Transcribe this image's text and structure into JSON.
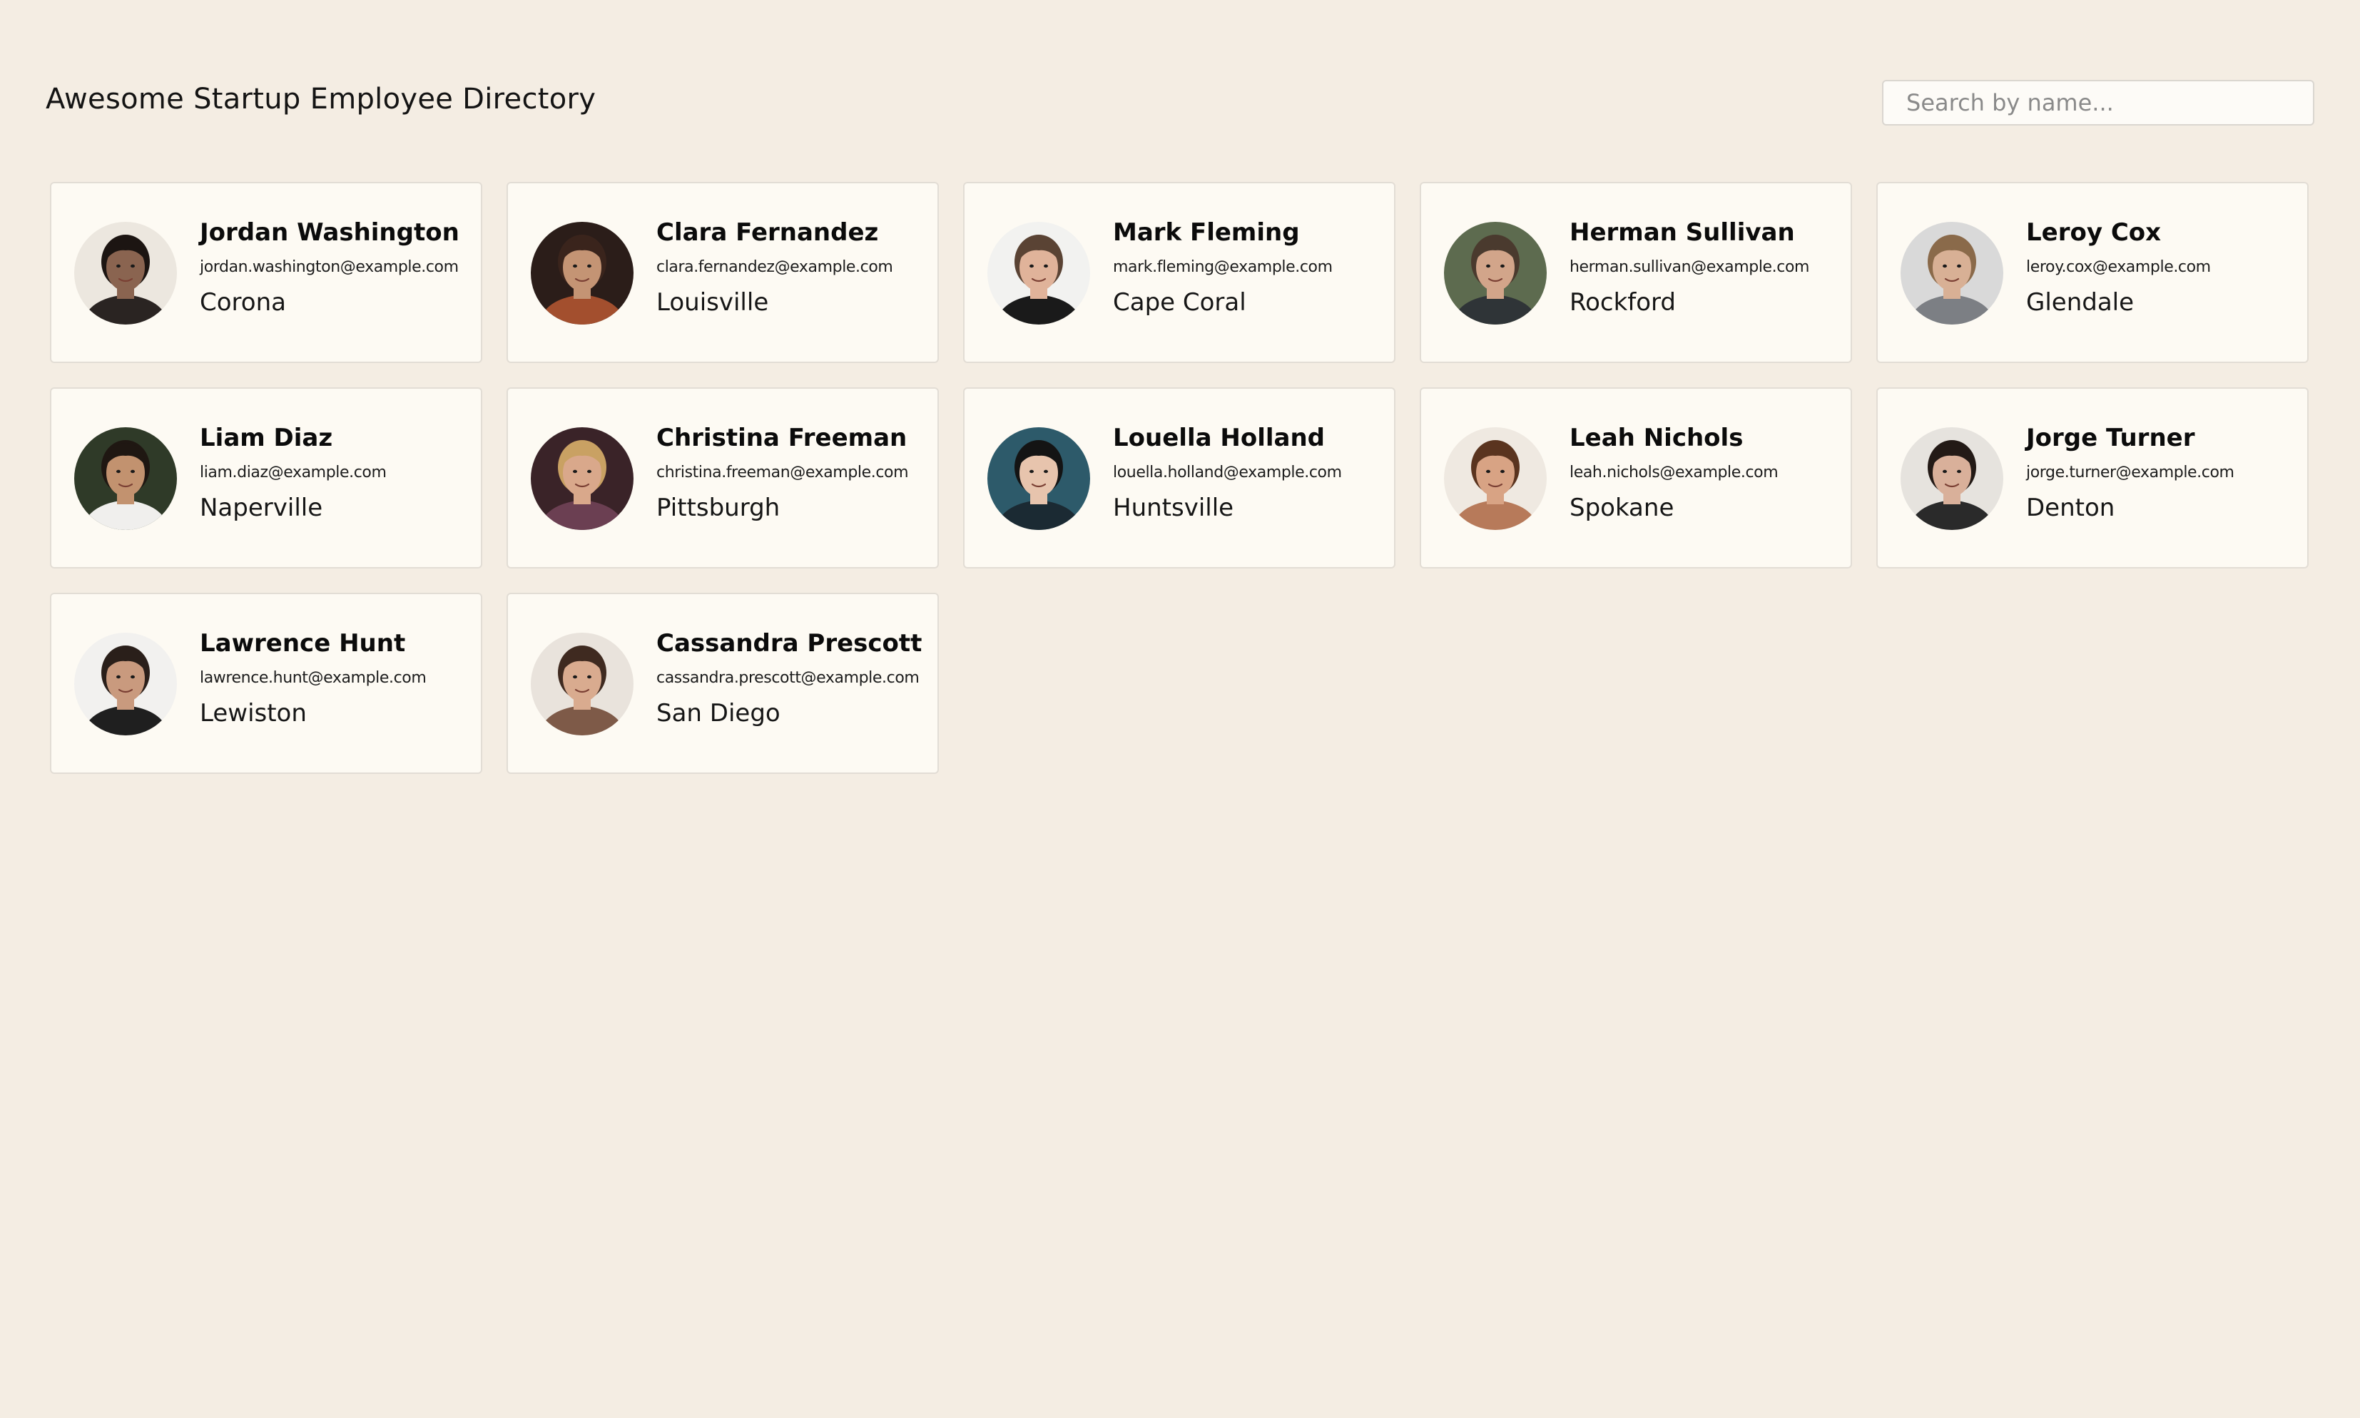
{
  "header": {
    "title": "Awesome Startup Employee Directory",
    "search_placeholder": "Search by name..."
  },
  "employees": [
    {
      "name": "Jordan Washington",
      "email": "jordan.washington@example.com",
      "city": "Corona",
      "bg": "#ece7df",
      "skin": "#8a6450",
      "hair": "#1c1512",
      "shirt": "#2a2422"
    },
    {
      "name": "Clara Fernandez",
      "email": "clara.fernandez@example.com",
      "city": "Louisville",
      "bg": "#2b1d19",
      "skin": "#c49474",
      "hair": "#3a241c",
      "shirt": "#a34f2e"
    },
    {
      "name": "Mark Fleming",
      "email": "mark.fleming@example.com",
      "city": "Cape Coral",
      "bg": "#f2f2f0",
      "skin": "#e0b39a",
      "hair": "#5a4334",
      "shirt": "#1a1a1a"
    },
    {
      "name": "Herman Sullivan",
      "email": "herman.sullivan@example.com",
      "city": "Rockford",
      "bg": "#5d6b4f",
      "skin": "#d2a58a",
      "hair": "#4a3a2e",
      "shirt": "#2f3437"
    },
    {
      "name": "Leroy Cox",
      "email": "leroy.cox@example.com",
      "city": "Glendale",
      "bg": "#d9d9d9",
      "skin": "#d8b095",
      "hair": "#8a6a4a",
      "shirt": "#7c7f84"
    },
    {
      "name": "Liam Diaz",
      "email": "liam.diaz@example.com",
      "city": "Naperville",
      "bg": "#2f3a28",
      "skin": "#c2926f",
      "hair": "#1f1712",
      "shirt": "#f0efed"
    },
    {
      "name": "Christina Freeman",
      "email": "christina.freeman@example.com",
      "city": "Pittsburgh",
      "bg": "#3a2328",
      "skin": "#d9a88b",
      "hair": "#c9a163",
      "shirt": "#6b3f52"
    },
    {
      "name": "Louella Holland",
      "email": "louella.holland@example.com",
      "city": "Huntsville",
      "bg": "#2d5a6a",
      "skin": "#e7c4ad",
      "hair": "#141414",
      "shirt": "#1b2a33"
    },
    {
      "name": "Leah Nichols",
      "email": "leah.nichols@example.com",
      "city": "Spokane",
      "bg": "#efe9e1",
      "skin": "#d8a384",
      "hair": "#5a341f",
      "shirt": "#b77a5a"
    },
    {
      "name": "Jorge Turner",
      "email": "jorge.turner@example.com",
      "city": "Denton",
      "bg": "#e6e3de",
      "skin": "#d9b09a",
      "hair": "#231a16",
      "shirt": "#2a2a2a"
    },
    {
      "name": "Lawrence Hunt",
      "email": "lawrence.hunt@example.com",
      "city": "Lewiston",
      "bg": "#f2f1ef",
      "skin": "#c99a7e",
      "hair": "#2a1f1a",
      "shirt": "#1f1f1f"
    },
    {
      "name": "Cassandra Prescott",
      "email": "cassandra.prescott@example.com",
      "city": "San Diego",
      "bg": "#e9e3dc",
      "skin": "#d9ab8f",
      "hair": "#3f2a20",
      "shirt": "#7e5a48"
    }
  ]
}
